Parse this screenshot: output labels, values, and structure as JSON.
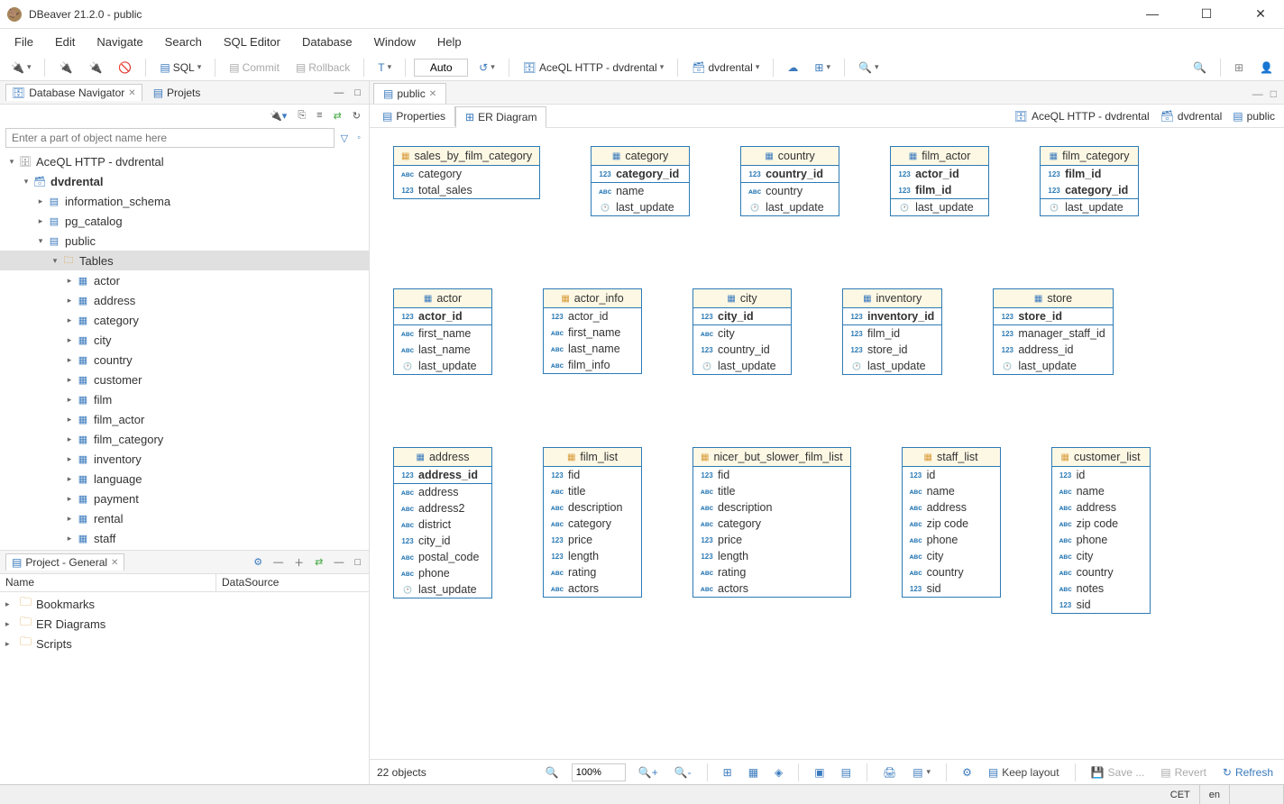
{
  "window": {
    "title": "DBeaver 21.2.0 - public"
  },
  "menu": [
    "File",
    "Edit",
    "Navigate",
    "Search",
    "SQL Editor",
    "Database",
    "Window",
    "Help"
  ],
  "toolbar": {
    "sql": "SQL",
    "commit": "Commit",
    "rollback": "Rollback",
    "auto": "Auto",
    "conn": "AceQL HTTP - dvdrental",
    "db": "dvdrental"
  },
  "nav": {
    "tab1": "Database Navigator",
    "tab2": "Projets",
    "placeholder": "Enter a part of object name here",
    "root": "AceQL HTTP - dvdrental",
    "db": "dvdrental",
    "schemas": [
      "information_schema",
      "pg_catalog",
      "public"
    ],
    "tablesLabel": "Tables",
    "tables": [
      "actor",
      "address",
      "category",
      "city",
      "country",
      "customer",
      "film",
      "film_actor",
      "film_category",
      "inventory",
      "language",
      "payment",
      "rental",
      "staff"
    ]
  },
  "project": {
    "title": "Project - General",
    "col1": "Name",
    "col2": "DataSource",
    "items": [
      "Bookmarks",
      "ER Diagrams",
      "Scripts"
    ]
  },
  "editor": {
    "tab": "public",
    "sub1": "Properties",
    "sub2": "ER Diagram",
    "crumb1": "AceQL HTTP - dvdrental",
    "crumb2": "dvdrental",
    "crumb3": "public"
  },
  "erd": {
    "rows": [
      [
        {
          "name": "sales_by_film_category",
          "type": "view",
          "pk": [],
          "cols": [
            [
              "str",
              "category"
            ],
            [
              "num",
              "total_sales"
            ]
          ]
        },
        {
          "name": "category",
          "type": "table",
          "pk": [
            [
              "num",
              "category_id"
            ]
          ],
          "cols": [
            [
              "str",
              "name"
            ],
            [
              "dt",
              "last_update"
            ]
          ]
        },
        {
          "name": "country",
          "type": "table",
          "pk": [
            [
              "num",
              "country_id"
            ]
          ],
          "cols": [
            [
              "str",
              "country"
            ],
            [
              "dt",
              "last_update"
            ]
          ]
        },
        {
          "name": "film_actor",
          "type": "table",
          "pk": [
            [
              "num",
              "actor_id"
            ],
            [
              "num",
              "film_id"
            ]
          ],
          "cols": [
            [
              "dt",
              "last_update"
            ]
          ]
        },
        {
          "name": "film_category",
          "type": "table",
          "pk": [
            [
              "num",
              "film_id"
            ],
            [
              "num",
              "category_id"
            ]
          ],
          "cols": [
            [
              "dt",
              "last_update"
            ]
          ]
        }
      ],
      [
        {
          "name": "actor",
          "type": "table",
          "pk": [
            [
              "num",
              "actor_id"
            ]
          ],
          "cols": [
            [
              "str",
              "first_name"
            ],
            [
              "str",
              "last_name"
            ],
            [
              "dt",
              "last_update"
            ]
          ]
        },
        {
          "name": "actor_info",
          "type": "view",
          "pk": [],
          "cols": [
            [
              "num",
              "actor_id"
            ],
            [
              "str",
              "first_name"
            ],
            [
              "str",
              "last_name"
            ],
            [
              "str",
              "film_info"
            ]
          ]
        },
        {
          "name": "city",
          "type": "table",
          "pk": [
            [
              "num",
              "city_id"
            ]
          ],
          "cols": [
            [
              "str",
              "city"
            ],
            [
              "num",
              "country_id"
            ],
            [
              "dt",
              "last_update"
            ]
          ]
        },
        {
          "name": "inventory",
          "type": "table",
          "pk": [
            [
              "num",
              "inventory_id"
            ]
          ],
          "cols": [
            [
              "num",
              "film_id"
            ],
            [
              "num",
              "store_id"
            ],
            [
              "dt",
              "last_update"
            ]
          ]
        },
        {
          "name": "store",
          "type": "table",
          "pk": [
            [
              "num",
              "store_id"
            ]
          ],
          "cols": [
            [
              "num",
              "manager_staff_id"
            ],
            [
              "num",
              "address_id"
            ],
            [
              "dt",
              "last_update"
            ]
          ]
        }
      ],
      [
        {
          "name": "address",
          "type": "table",
          "pk": [
            [
              "num",
              "address_id"
            ]
          ],
          "cols": [
            [
              "str",
              "address"
            ],
            [
              "str",
              "address2"
            ],
            [
              "str",
              "district"
            ],
            [
              "num",
              "city_id"
            ],
            [
              "str",
              "postal_code"
            ],
            [
              "str",
              "phone"
            ],
            [
              "dt",
              "last_update"
            ]
          ]
        },
        {
          "name": "film_list",
          "type": "view",
          "pk": [],
          "cols": [
            [
              "num",
              "fid"
            ],
            [
              "str",
              "title"
            ],
            [
              "str",
              "description"
            ],
            [
              "str",
              "category"
            ],
            [
              "num",
              "price"
            ],
            [
              "num",
              "length"
            ],
            [
              "str",
              "rating"
            ],
            [
              "str",
              "actors"
            ]
          ]
        },
        {
          "name": "nicer_but_slower_film_list",
          "type": "view",
          "pk": [],
          "cols": [
            [
              "num",
              "fid"
            ],
            [
              "str",
              "title"
            ],
            [
              "str",
              "description"
            ],
            [
              "str",
              "category"
            ],
            [
              "num",
              "price"
            ],
            [
              "num",
              "length"
            ],
            [
              "str",
              "rating"
            ],
            [
              "str",
              "actors"
            ]
          ]
        },
        {
          "name": "staff_list",
          "type": "view",
          "pk": [],
          "cols": [
            [
              "num",
              "id"
            ],
            [
              "str",
              "name"
            ],
            [
              "str",
              "address"
            ],
            [
              "str",
              "zip code"
            ],
            [
              "str",
              "phone"
            ],
            [
              "str",
              "city"
            ],
            [
              "str",
              "country"
            ],
            [
              "num",
              "sid"
            ]
          ]
        },
        {
          "name": "customer_list",
          "type": "view",
          "pk": [],
          "cols": [
            [
              "num",
              "id"
            ],
            [
              "str",
              "name"
            ],
            [
              "str",
              "address"
            ],
            [
              "str",
              "zip code"
            ],
            [
              "str",
              "phone"
            ],
            [
              "str",
              "city"
            ],
            [
              "str",
              "country"
            ],
            [
              "str",
              "notes"
            ],
            [
              "num",
              "sid"
            ]
          ]
        }
      ]
    ]
  },
  "bottom": {
    "objects": "22 objects",
    "zoom": "100%",
    "keep": "Keep layout",
    "save": "Save ...",
    "revert": "Revert",
    "refresh": "Refresh"
  },
  "status": {
    "tz": "CET",
    "lang": "en"
  }
}
